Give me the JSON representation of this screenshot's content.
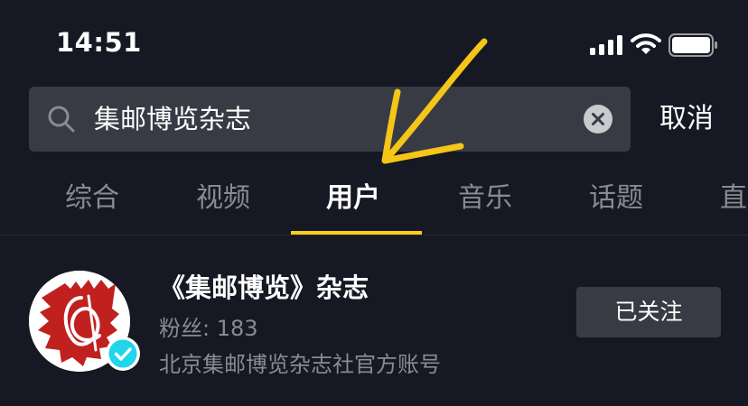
{
  "status_bar": {
    "time": "14:51"
  },
  "search": {
    "query": "集邮博览杂志",
    "cancel_label": "取消"
  },
  "tabs": [
    {
      "label": "综合",
      "active": false
    },
    {
      "label": "视频",
      "active": false
    },
    {
      "label": "用户",
      "active": true
    },
    {
      "label": "音乐",
      "active": false
    },
    {
      "label": "话题",
      "active": false
    },
    {
      "label": "直",
      "active": false
    }
  ],
  "user_result": {
    "name": "《集邮博览》杂志",
    "followers": "粉丝: 183",
    "description": "北京集邮博览杂志社官方账号",
    "follow_label": "已关注",
    "verified": true
  },
  "colors": {
    "background": "#161823",
    "search_bg": "#393b44",
    "tab_underline": "#face15",
    "secondary_text": "#8a8b91",
    "verified_blue": "#20d5ec",
    "arrow_yellow": "#f5c518"
  },
  "icons": {
    "search": "search-icon",
    "clear": "clear-icon",
    "signal": "signal-icon",
    "wifi": "wifi-icon",
    "battery": "battery-icon",
    "verified": "verified-badge-icon",
    "annotation_arrow": "arrow-icon"
  }
}
